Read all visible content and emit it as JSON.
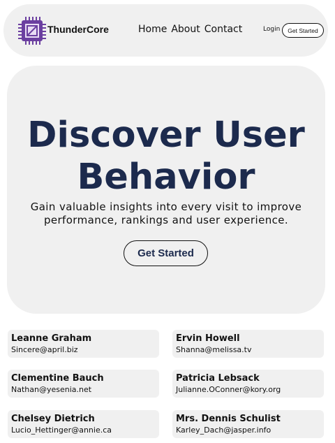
{
  "header": {
    "brand": "ThunderCore",
    "nav": [
      "Home",
      "About",
      "Contact"
    ],
    "login": "Login",
    "cta": "Get Started"
  },
  "hero": {
    "title": "Discover User Behavior",
    "subtitle": "Gain valuable insights into every visit to improve performance, rankings and user experience.",
    "cta": "Get Started"
  },
  "users": [
    {
      "name": "Leanne Graham",
      "email": "Sincere@april.biz"
    },
    {
      "name": "Ervin Howell",
      "email": "Shanna@melissa.tv"
    },
    {
      "name": "Clementine Bauch",
      "email": "Nathan@yesenia.net"
    },
    {
      "name": "Patricia Lebsack",
      "email": "Julianne.OConner@kory.org"
    },
    {
      "name": "Chelsey Dietrich",
      "email": "Lucio_Hettinger@annie.ca"
    },
    {
      "name": "Mrs. Dennis Schulist",
      "email": "Karley_Dach@jasper.info"
    }
  ],
  "colors": {
    "accent": "#1c2a4d",
    "logo": "#6b3fa0",
    "panel": "#f0f0f0"
  },
  "icons": {
    "logo": "cpu-chip-icon"
  }
}
